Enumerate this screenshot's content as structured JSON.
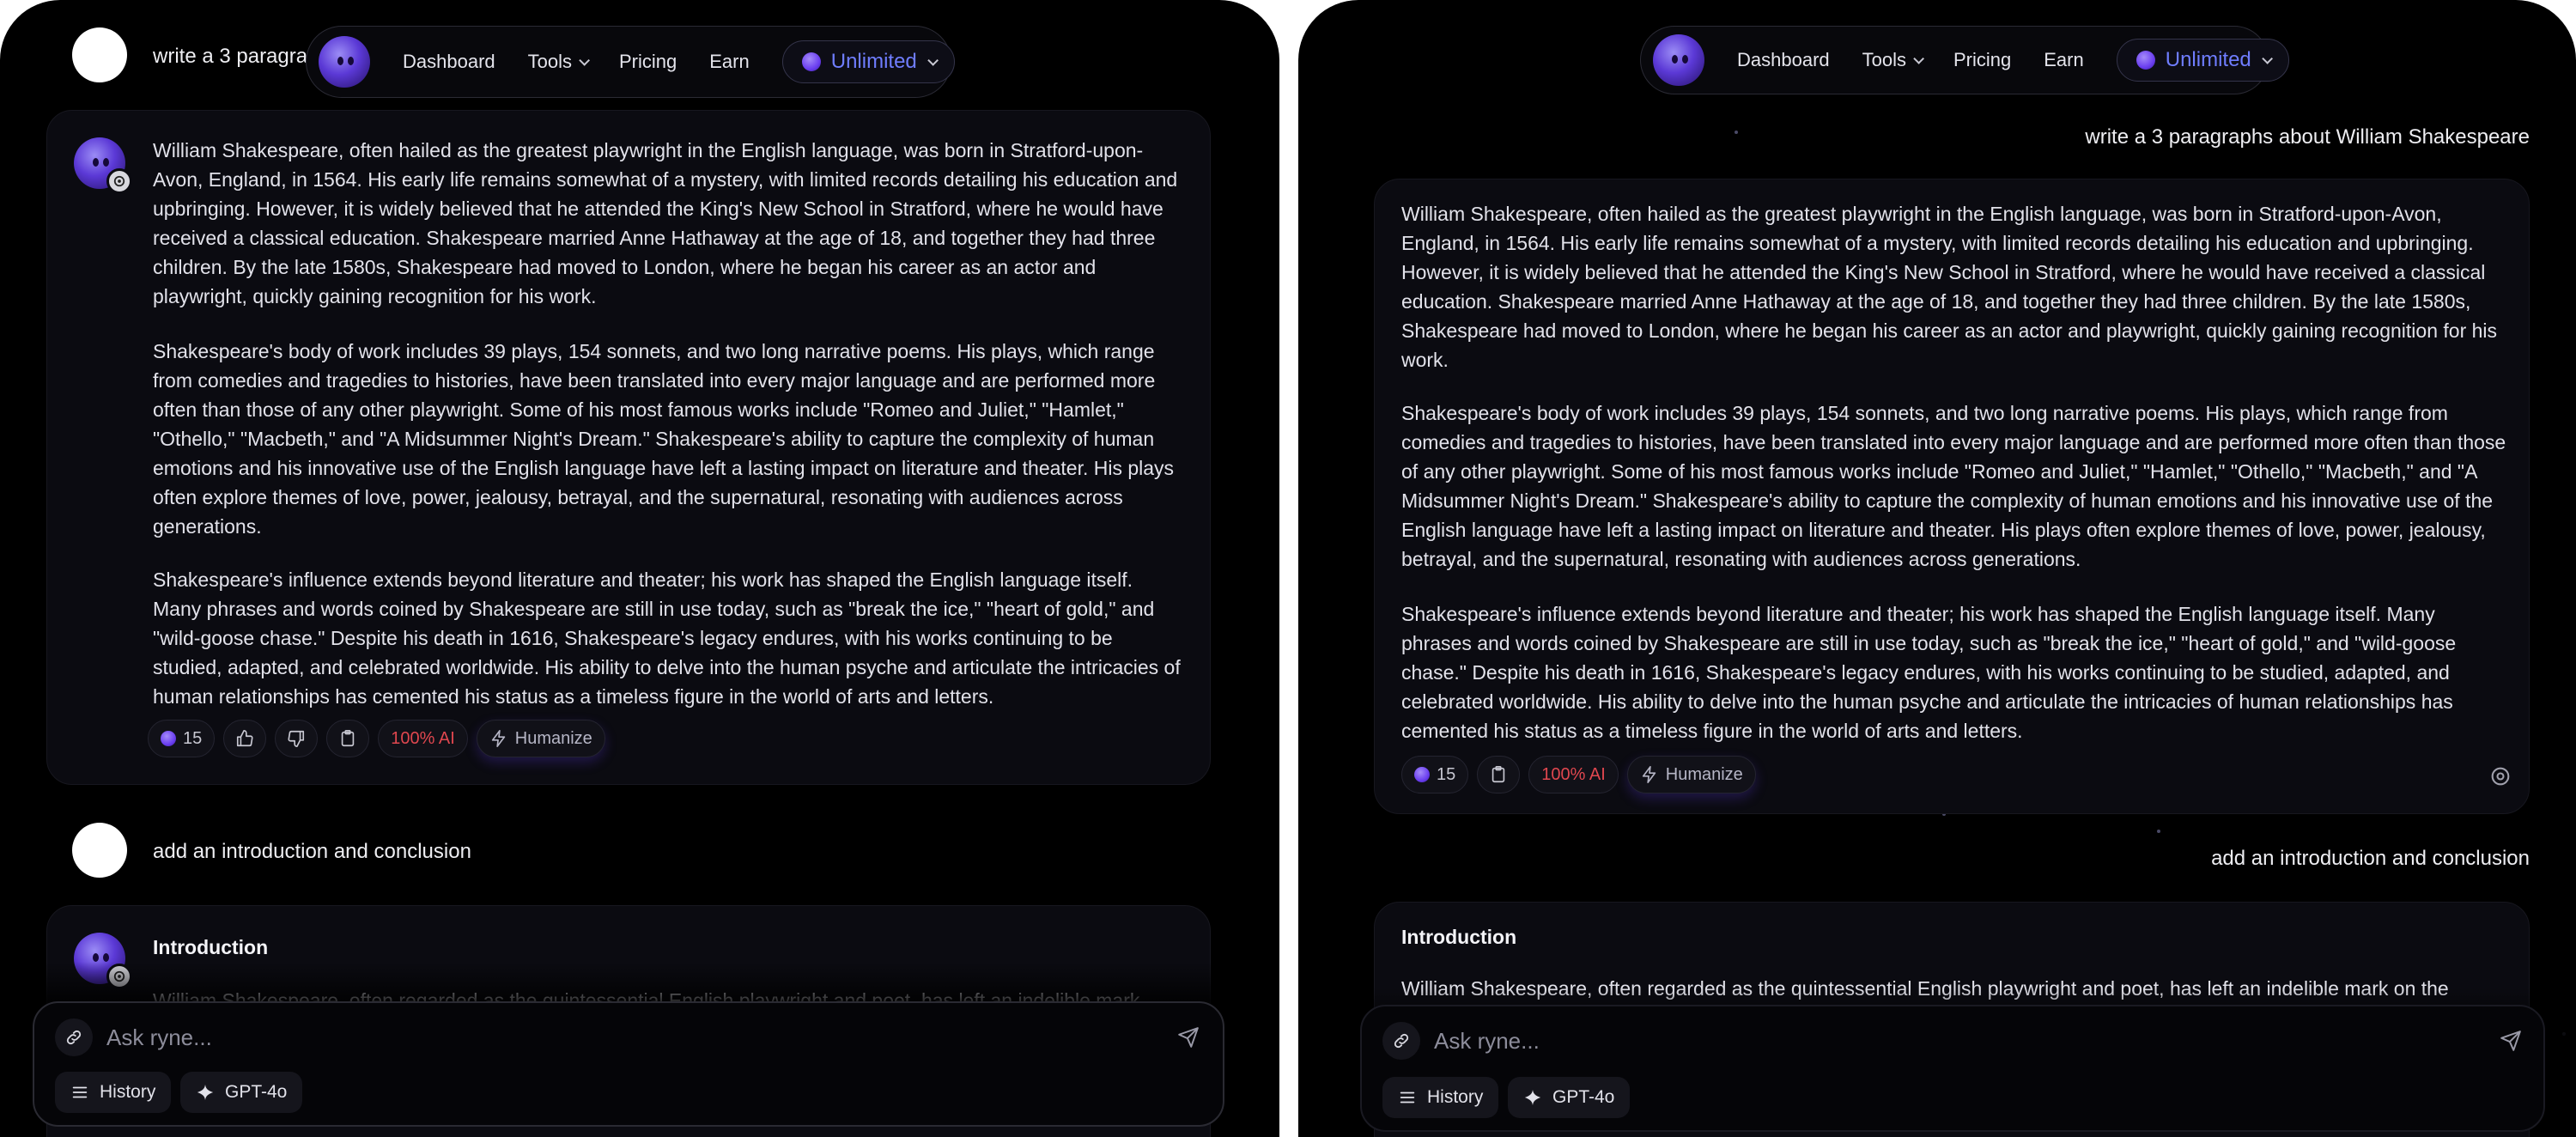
{
  "nav": {
    "dashboard": "Dashboard",
    "tools": "Tools",
    "pricing": "Pricing",
    "earn": "Earn",
    "plan": "Unlimited"
  },
  "conversation": {
    "prompt1": "write a 3 paragraphs about William Shakespeare",
    "prompt1_truncated": "write a 3 paragra",
    "answer1": {
      "p1": "William Shakespeare, often hailed as the greatest playwright in the English language, was born in Stratford-upon-Avon, England, in 1564. His early life remains somewhat of a mystery, with limited records detailing his education and upbringing. However, it is widely believed that he attended the King's New School in Stratford, where he would have received a classical education. Shakespeare married Anne Hathaway at the age of 18, and together they had three children. By the late 1580s, Shakespeare had moved to London, where he began his career as an actor and playwright, quickly gaining recognition for his work.",
      "p2": "Shakespeare's body of work includes 39 plays, 154 sonnets, and two long narrative poems. His plays, which range from comedies and tragedies to histories, have been translated into every major language and are performed more often than those of any other playwright. Some of his most famous works include \"Romeo and Juliet,\" \"Hamlet,\" \"Othello,\" \"Macbeth,\" and \"A Midsummer Night's Dream.\" Shakespeare's ability to capture the complexity of human emotions and his innovative use of the English language have left a lasting impact on literature and theater. His plays often explore themes of love, power, jealousy, betrayal, and the supernatural, resonating with audiences across generations.",
      "p3": "Shakespeare's influence extends beyond literature and theater; his work has shaped the English language itself. Many phrases and words coined by Shakespeare are still in use today, such as \"break the ice,\" \"heart of gold,\" and \"wild-goose chase.\" Despite his death in 1616, Shakespeare's legacy endures, with his works continuing to be studied, adapted, and celebrated worldwide. His ability to delve into the human psyche and articulate the intricacies of human relationships has cemented his status as a timeless figure in the world of arts and letters."
    },
    "credits": "15",
    "ai_score": "100% AI",
    "humanize": "Humanize",
    "prompt2": "add an introduction and conclusion",
    "answer2": {
      "heading": "Introduction",
      "p1_left": "William Shakespeare, often regarded as the quintessential English playwright and poet, has left an indelible mark",
      "p1_right": "William Shakespeare, often regarded as the quintessential English playwright and poet, has left an indelible mark on the"
    }
  },
  "composer": {
    "placeholder": "Ask ryne...",
    "history": "History",
    "model": "GPT-4o"
  },
  "icons": {
    "link": "link-icon",
    "send": "send-icon",
    "history": "menu-icon",
    "model": "sparkle-icon",
    "like": "thumbs-up-icon",
    "dislike": "thumbs-down-icon",
    "copy": "clipboard-icon",
    "humanize": "lightning-icon",
    "openai": "openai-icon"
  },
  "colors": {
    "accent": "#6f7dff",
    "ai_score": "#e0474f",
    "background": "#000000"
  }
}
